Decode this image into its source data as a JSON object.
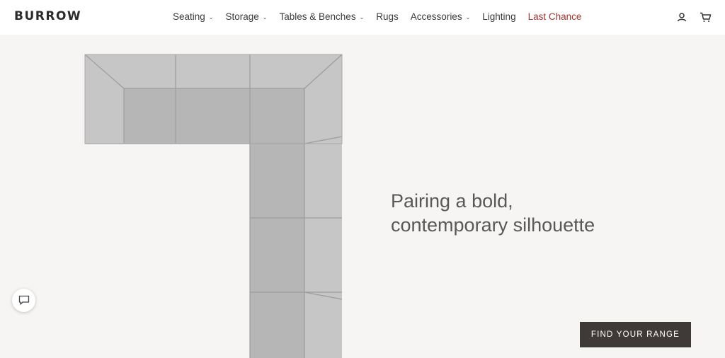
{
  "brand": {
    "name": "BURROW"
  },
  "nav": {
    "items": [
      {
        "label": "Seating",
        "has_dropdown": true
      },
      {
        "label": "Storage",
        "has_dropdown": true
      },
      {
        "label": "Tables & Benches",
        "has_dropdown": true
      },
      {
        "label": "Rugs",
        "has_dropdown": false
      },
      {
        "label": "Accessories",
        "has_dropdown": true
      },
      {
        "label": "Lighting",
        "has_dropdown": false
      },
      {
        "label": "Last Chance",
        "has_dropdown": false,
        "highlight": true
      }
    ]
  },
  "header_icons": [
    "account-icon",
    "cart-icon"
  ],
  "hero": {
    "headline_line1": "Pairing a bold,",
    "headline_line2": "contemporary silhouette",
    "cta_label": "FIND YOUR RANGE",
    "image": "top-down grey sectional sofa"
  },
  "chat_widget": {
    "icon": "chat-icon"
  },
  "colors": {
    "background": "#f7f5f4",
    "header": "#ffffff",
    "text": "#3a3a3a",
    "sale_accent": "#a3342d",
    "cta_bg": "#3f3a38",
    "sofa_fabric": "#bdbdbd"
  }
}
